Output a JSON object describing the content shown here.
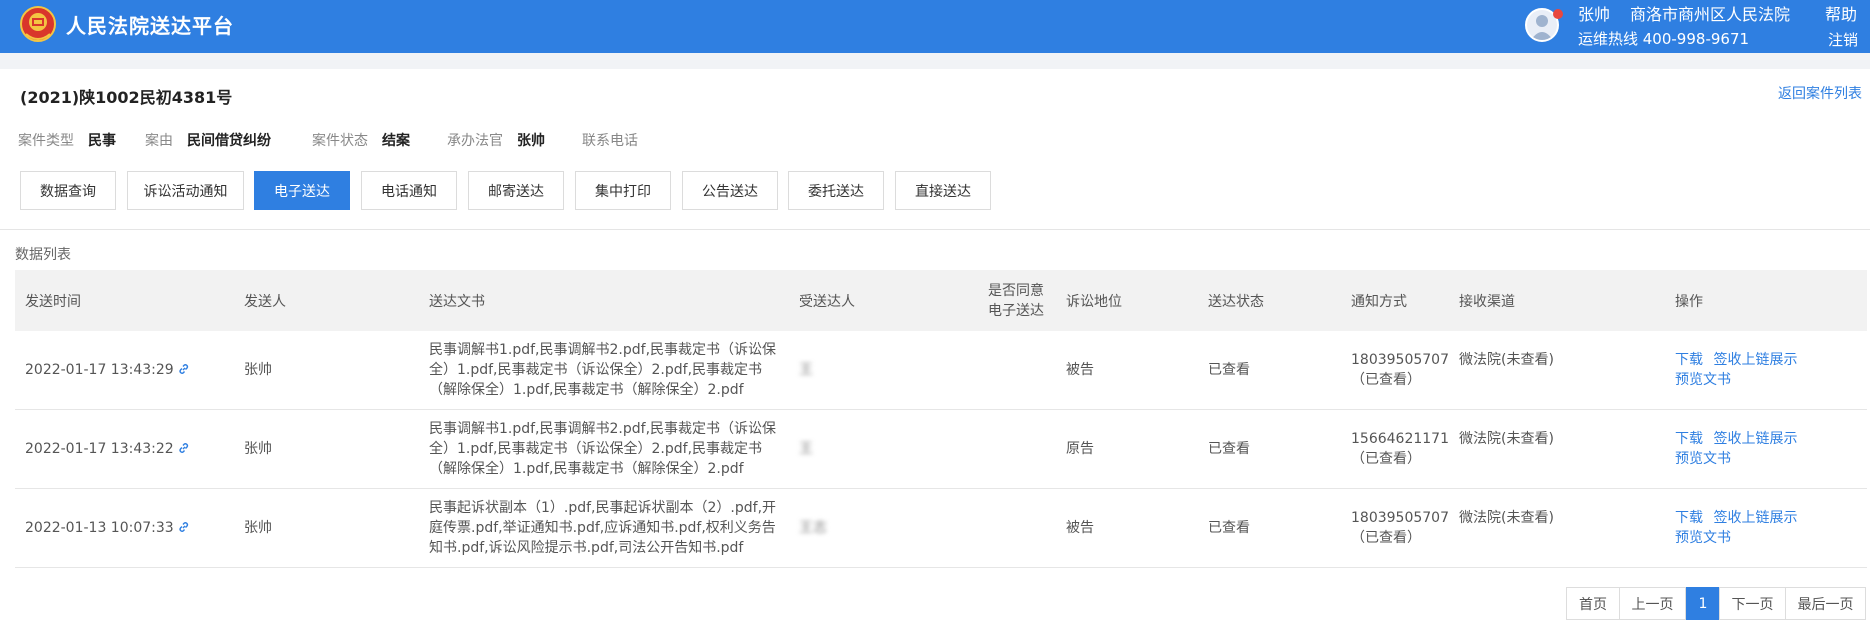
{
  "header": {
    "brand": "人民法院送达平台",
    "user_name": "张帅",
    "court": "商洛市商州区人民法院",
    "help": "帮助",
    "hotline": "运维热线 400-998-9671",
    "logout": "注销",
    "brand_color": "#2f7fe1"
  },
  "case": {
    "number": "(2021)陕1002民初4381号",
    "back_link": "返回案件列表",
    "meta": [
      {
        "label": "案件类型",
        "value": "民事"
      },
      {
        "label": "案由",
        "value": "民间借贷纠纷"
      },
      {
        "label": "案件状态",
        "value": "结案"
      },
      {
        "label": "承办法官",
        "value": "张帅"
      },
      {
        "label": "联系电话",
        "value": ""
      }
    ]
  },
  "tabs": [
    "数据查询",
    "诉讼活动通知",
    "电子送达",
    "电话通知",
    "邮寄送达",
    "集中打印",
    "公告送达",
    "委托送达",
    "直接送达"
  ],
  "active_tab": "电子送达",
  "list": {
    "title": "数据列表",
    "columns": [
      "发送时间",
      "发送人",
      "送达文书",
      "受送达人",
      "是否同意\n电子送达",
      "诉讼地位",
      "送达状态",
      "通知方式",
      "接收渠道",
      "操作"
    ],
    "rows": [
      {
        "time": "2022-01-17 13:43:29",
        "sender": "张帅",
        "docs": "民事调解书1.pdf,民事调解书2.pdf,民事裁定书（诉讼保全）1.pdf,民事裁定书（诉讼保全）2.pdf,民事裁定书（解除保全）1.pdf,民事裁定书（解除保全）2.pdf",
        "recipient": "王",
        "agree": "",
        "role": "被告",
        "status": "已查看",
        "notify_phone": "18039505707",
        "notify_state": "（已查看）",
        "channel": "微法院(未查看)",
        "op_download": "下载",
        "op_sign": "签收上链展示",
        "op_preview": "预览文书"
      },
      {
        "time": "2022-01-17 13:43:22",
        "sender": "张帅",
        "docs": "民事调解书1.pdf,民事调解书2.pdf,民事裁定书（诉讼保全）1.pdf,民事裁定书（诉讼保全）2.pdf,民事裁定书（解除保全）1.pdf,民事裁定书（解除保全）2.pdf",
        "recipient": "王",
        "agree": "",
        "role": "原告",
        "status": "已查看",
        "notify_phone": "15664621171",
        "notify_state": "（已查看）",
        "channel": "微法院(未查看)",
        "op_download": "下载",
        "op_sign": "签收上链展示",
        "op_preview": "预览文书"
      },
      {
        "time": "2022-01-13 10:07:33",
        "sender": "张帅",
        "docs": "民事起诉状副本（1）.pdf,民事起诉状副本（2）.pdf,开庭传票.pdf,举证通知书.pdf,应诉通知书.pdf,权利义务告知书.pdf,诉讼风险提示书.pdf,司法公开告知书.pdf",
        "recipient": "王志",
        "agree": "",
        "role": "被告",
        "status": "已查看",
        "notify_phone": "18039505707",
        "notify_state": "（已查看）",
        "channel": "微法院(未查看)",
        "op_download": "下载",
        "op_sign": "签收上链展示",
        "op_preview": "预览文书"
      }
    ]
  },
  "pagination": {
    "first": "首页",
    "prev": "上一页",
    "current": "1",
    "next": "下一页",
    "last": "最后一页"
  }
}
